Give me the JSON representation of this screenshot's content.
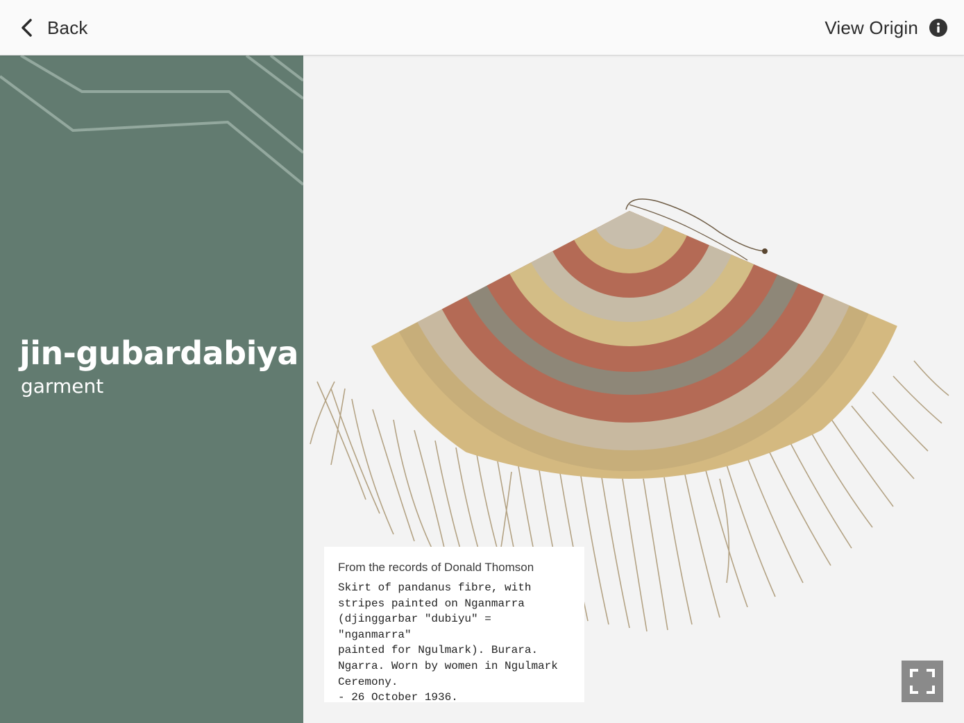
{
  "header": {
    "back_label": "Back",
    "view_origin_label": "View Origin"
  },
  "object": {
    "title": "jin-gubardabiya",
    "subtitle": "garment"
  },
  "caption": {
    "source": "From the records of Donald Thomson",
    "body": "Skirt of pandanus fibre, with\nstripes painted on Nganmarra\n(djinggarbar \"dubiyu\" = \"nganmarra\"\npainted for Ngulmark). Burara.\nNgarra. Worn by women in Ngulmark\nCeremony.\n- 26 October 1936."
  },
  "colors": {
    "panel": "#627b70",
    "viewer_bg": "#f3f3f3",
    "fullscreen_button": "#8a8a8a"
  },
  "icons": {
    "back": "chevron-left-icon",
    "info": "info-circle-icon",
    "fullscreen": "fullscreen-expand-icon"
  }
}
